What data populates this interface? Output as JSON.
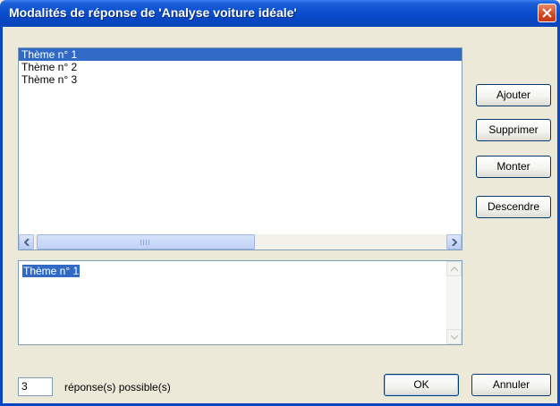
{
  "window": {
    "title": "Modalités de réponse de 'Analyse voiture idéale'"
  },
  "list": {
    "items": [
      "Thème n° 1",
      "Thème n° 2",
      "Thème n° 3"
    ],
    "selected_index": 0
  },
  "editor": {
    "value": "Thème n° 1"
  },
  "buttons": {
    "add": "Ajouter",
    "delete": "Supprimer",
    "up": "Monter",
    "down": "Descendre",
    "ok": "OK",
    "cancel": "Annuler"
  },
  "responses": {
    "count": "3",
    "label": "réponse(s) possible(s)"
  },
  "colors": {
    "title_bar": "#0a4fd0",
    "selection": "#316ac5",
    "face": "#ece9d8"
  },
  "icons": {
    "close": "close-icon",
    "scroll_left": "arrow-left-icon",
    "scroll_right": "arrow-right-icon",
    "scroll_up": "arrow-up-icon",
    "scroll_down": "arrow-down-icon"
  }
}
